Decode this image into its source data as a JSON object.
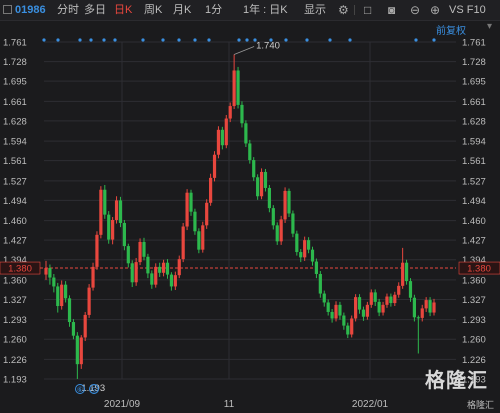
{
  "toolbar": {
    "code": "01986",
    "tabs": [
      "分时",
      "多日",
      "日K",
      "周K",
      "月K",
      "1分",
      "1年 : 日K",
      "显示"
    ],
    "active_tab": "日K",
    "right_text": "VS F10"
  },
  "adjust_label": "前复权",
  "watermark": "格隆汇",
  "watermark_sub": "格隆汇",
  "current_price_label": "1.380",
  "max_label": "1.740",
  "min_label": "1.193",
  "event_markers": [
    "⑥",
    "Ⓖ"
  ],
  "colors": {
    "up": "#e8473e",
    "down": "#2db84d",
    "background": "#1b1b1d",
    "grid": "#2e2e33",
    "accent": "#3a8fe0"
  },
  "chart_data": {
    "type": "candlestick",
    "y_ticks": [
      "1.761",
      "1.728",
      "1.695",
      "1.661",
      "1.628",
      "1.594",
      "1.561",
      "1.527",
      "1.494",
      "1.460",
      "1.427",
      "1.394",
      "1.360",
      "1.327",
      "1.293",
      "1.260",
      "1.226",
      "1.193"
    ],
    "y_range": [
      1.193,
      1.761
    ],
    "x_labels": [
      "2021/09",
      "11",
      "2022/01"
    ],
    "current_price": 1.38,
    "high": 1.74,
    "low": 1.193,
    "candles": [
      [
        1.369,
        1.38,
        1.392,
        1.36
      ],
      [
        1.38,
        1.364,
        1.386,
        1.352
      ],
      [
        1.364,
        1.349,
        1.37,
        1.339
      ],
      [
        1.349,
        1.316,
        1.355,
        1.305
      ],
      [
        1.316,
        1.352,
        1.359,
        1.31
      ],
      [
        1.352,
        1.329,
        1.358,
        1.322
      ],
      [
        1.329,
        1.289,
        1.334,
        1.281
      ],
      [
        1.289,
        1.266,
        1.294,
        1.26
      ],
      [
        1.266,
        1.218,
        1.272,
        1.193
      ],
      [
        1.218,
        1.263,
        1.267,
        1.21
      ],
      [
        1.263,
        1.301,
        1.306,
        1.257
      ],
      [
        1.301,
        1.347,
        1.353,
        1.296
      ],
      [
        1.347,
        1.382,
        1.389,
        1.342
      ],
      [
        1.382,
        1.436,
        1.442,
        1.377
      ],
      [
        1.436,
        1.512,
        1.518,
        1.43
      ],
      [
        1.512,
        1.47,
        1.52,
        1.463
      ],
      [
        1.47,
        1.428,
        1.476,
        1.421
      ],
      [
        1.428,
        1.461,
        1.466,
        1.42
      ],
      [
        1.461,
        1.494,
        1.501,
        1.455
      ],
      [
        1.494,
        1.456,
        1.5,
        1.449
      ],
      [
        1.456,
        1.417,
        1.461,
        1.41
      ],
      [
        1.417,
        1.388,
        1.421,
        1.381
      ],
      [
        1.388,
        1.356,
        1.393,
        1.348
      ],
      [
        1.356,
        1.39,
        1.397,
        1.35
      ],
      [
        1.39,
        1.424,
        1.43,
        1.385
      ],
      [
        1.424,
        1.399,
        1.431,
        1.393
      ],
      [
        1.399,
        1.371,
        1.404,
        1.363
      ],
      [
        1.371,
        1.352,
        1.376,
        1.345
      ],
      [
        1.352,
        1.382,
        1.388,
        1.347
      ],
      [
        1.382,
        1.372,
        1.389,
        1.365
      ],
      [
        1.372,
        1.389,
        1.394,
        1.366
      ],
      [
        1.389,
        1.369,
        1.395,
        1.362
      ],
      [
        1.369,
        1.349,
        1.373,
        1.342
      ],
      [
        1.349,
        1.368,
        1.374,
        1.343
      ],
      [
        1.368,
        1.395,
        1.401,
        1.363
      ],
      [
        1.395,
        1.45,
        1.456,
        1.39
      ],
      [
        1.45,
        1.507,
        1.513,
        1.444
      ],
      [
        1.507,
        1.475,
        1.512,
        1.468
      ],
      [
        1.475,
        1.442,
        1.48,
        1.436
      ],
      [
        1.442,
        1.411,
        1.447,
        1.405
      ],
      [
        1.411,
        1.452,
        1.458,
        1.406
      ],
      [
        1.452,
        1.49,
        1.496,
        1.446
      ],
      [
        1.49,
        1.532,
        1.539,
        1.485
      ],
      [
        1.532,
        1.571,
        1.577,
        1.526
      ],
      [
        1.571,
        1.613,
        1.619,
        1.565
      ],
      [
        1.613,
        1.587,
        1.618,
        1.58
      ],
      [
        1.587,
        1.632,
        1.638,
        1.582
      ],
      [
        1.632,
        1.653,
        1.659,
        1.626
      ],
      [
        1.653,
        1.713,
        1.74,
        1.648
      ],
      [
        1.713,
        1.655,
        1.719,
        1.649
      ],
      [
        1.655,
        1.624,
        1.661,
        1.617
      ],
      [
        1.624,
        1.59,
        1.629,
        1.584
      ],
      [
        1.59,
        1.562,
        1.596,
        1.556
      ],
      [
        1.562,
        1.533,
        1.567,
        1.527
      ],
      [
        1.533,
        1.501,
        1.538,
        1.495
      ],
      [
        1.501,
        1.542,
        1.548,
        1.496
      ],
      [
        1.542,
        1.515,
        1.547,
        1.509
      ],
      [
        1.515,
        1.481,
        1.52,
        1.474
      ],
      [
        1.481,
        1.452,
        1.486,
        1.445
      ],
      [
        1.452,
        1.425,
        1.457,
        1.419
      ],
      [
        1.425,
        1.462,
        1.468,
        1.419
      ],
      [
        1.462,
        1.51,
        1.516,
        1.456
      ],
      [
        1.51,
        1.472,
        1.514,
        1.466
      ],
      [
        1.472,
        1.438,
        1.477,
        1.432
      ],
      [
        1.438,
        1.407,
        1.443,
        1.401
      ],
      [
        1.407,
        1.398,
        1.412,
        1.39
      ],
      [
        1.398,
        1.427,
        1.433,
        1.392
      ],
      [
        1.427,
        1.411,
        1.432,
        1.405
      ],
      [
        1.411,
        1.391,
        1.416,
        1.384
      ],
      [
        1.391,
        1.37,
        1.396,
        1.363
      ],
      [
        1.37,
        1.337,
        1.375,
        1.33
      ],
      [
        1.337,
        1.322,
        1.342,
        1.315
      ],
      [
        1.322,
        1.306,
        1.327,
        1.3
      ],
      [
        1.306,
        1.295,
        1.311,
        1.288
      ],
      [
        1.295,
        1.318,
        1.324,
        1.29
      ],
      [
        1.318,
        1.3,
        1.323,
        1.293
      ],
      [
        1.3,
        1.283,
        1.305,
        1.276
      ],
      [
        1.283,
        1.268,
        1.288,
        1.262
      ],
      [
        1.268,
        1.295,
        1.3,
        1.263
      ],
      [
        1.295,
        1.331,
        1.336,
        1.29
      ],
      [
        1.331,
        1.31,
        1.336,
        1.303
      ],
      [
        1.31,
        1.298,
        1.315,
        1.291
      ],
      [
        1.298,
        1.318,
        1.323,
        1.293
      ],
      [
        1.318,
        1.339,
        1.344,
        1.313
      ],
      [
        1.339,
        1.323,
        1.344,
        1.316
      ],
      [
        1.323,
        1.305,
        1.328,
        1.299
      ],
      [
        1.305,
        1.318,
        1.323,
        1.3
      ],
      [
        1.318,
        1.332,
        1.337,
        1.313
      ],
      [
        1.332,
        1.321,
        1.337,
        1.315
      ],
      [
        1.321,
        1.335,
        1.34,
        1.316
      ],
      [
        1.335,
        1.35,
        1.356,
        1.33
      ],
      [
        1.35,
        1.389,
        1.414,
        1.345
      ],
      [
        1.389,
        1.358,
        1.394,
        1.352
      ],
      [
        1.358,
        1.33,
        1.363,
        1.323
      ],
      [
        1.33,
        1.297,
        1.335,
        1.29
      ],
      [
        1.297,
        1.296,
        1.3,
        1.236
      ],
      [
        1.296,
        1.312,
        1.318,
        1.29
      ],
      [
        1.312,
        1.326,
        1.331,
        1.306
      ],
      [
        1.326,
        1.305,
        1.331,
        1.299
      ],
      [
        1.305,
        1.322,
        1.328,
        1.3
      ]
    ]
  }
}
